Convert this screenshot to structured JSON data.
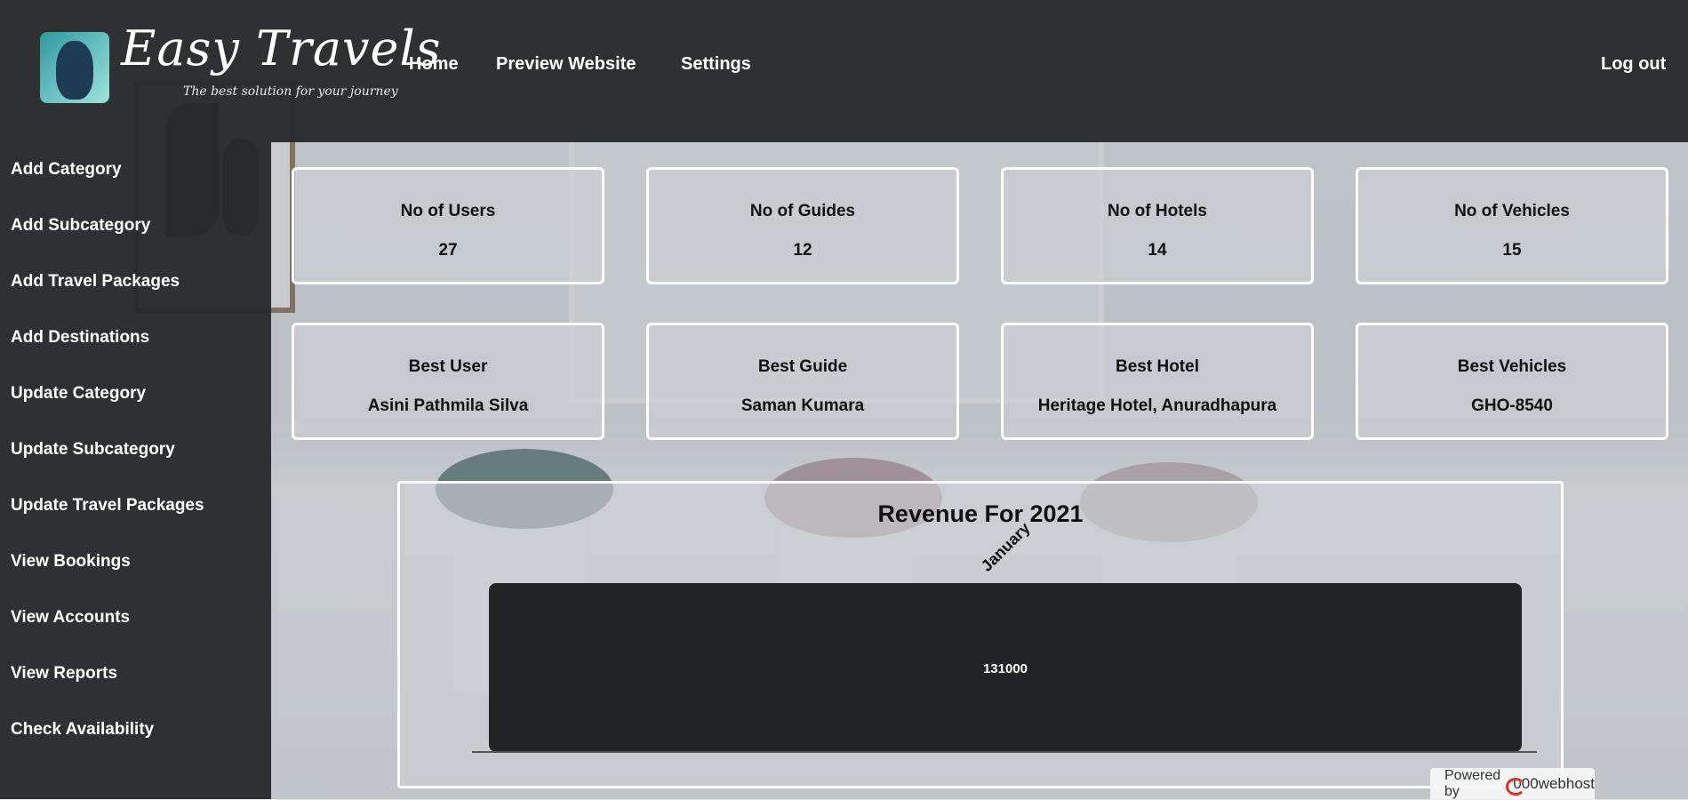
{
  "header": {
    "brand": "Easy Travels",
    "tagline": "The best solution for your journey",
    "nav": {
      "home": "Home",
      "preview": "Preview Website",
      "settings": "Settings",
      "logout": "Log out"
    }
  },
  "sidebar": {
    "items": [
      {
        "label": "Add Category"
      },
      {
        "label": "Add Subcategory"
      },
      {
        "label": "Add Travel Packages"
      },
      {
        "label": "Add Destinations"
      },
      {
        "label": "Update Category"
      },
      {
        "label": "Update Subcategory"
      },
      {
        "label": "Update Travel Packages"
      },
      {
        "label": "View Bookings"
      },
      {
        "label": "View Accounts"
      },
      {
        "label": "View Reports"
      },
      {
        "label": "Check Availability"
      }
    ]
  },
  "stats": [
    {
      "label": "No of Users",
      "value": "27"
    },
    {
      "label": "No of Guides",
      "value": "12"
    },
    {
      "label": "No of Hotels",
      "value": "14"
    },
    {
      "label": "No of Vehicles",
      "value": "15"
    }
  ],
  "best": [
    {
      "label": "Best User",
      "value": "Asini Pathmila Silva"
    },
    {
      "label": "Best Guide",
      "value": "Saman Kumara"
    },
    {
      "label": "Best Hotel",
      "value": "Heritage Hotel, Anuradhapura"
    },
    {
      "label": "Best Vehicles",
      "value": "GHO-8540"
    }
  ],
  "chart_data": {
    "type": "bar",
    "title": "Revenue For 2021",
    "categories": [
      "January"
    ],
    "values": [
      131000
    ],
    "data_labels": [
      "131000"
    ],
    "bar_color": "#232425",
    "xlabel": "",
    "ylabel": "",
    "grid": false
  },
  "footer_badge": {
    "powered_by": "Powered by",
    "host": "000webhost"
  }
}
